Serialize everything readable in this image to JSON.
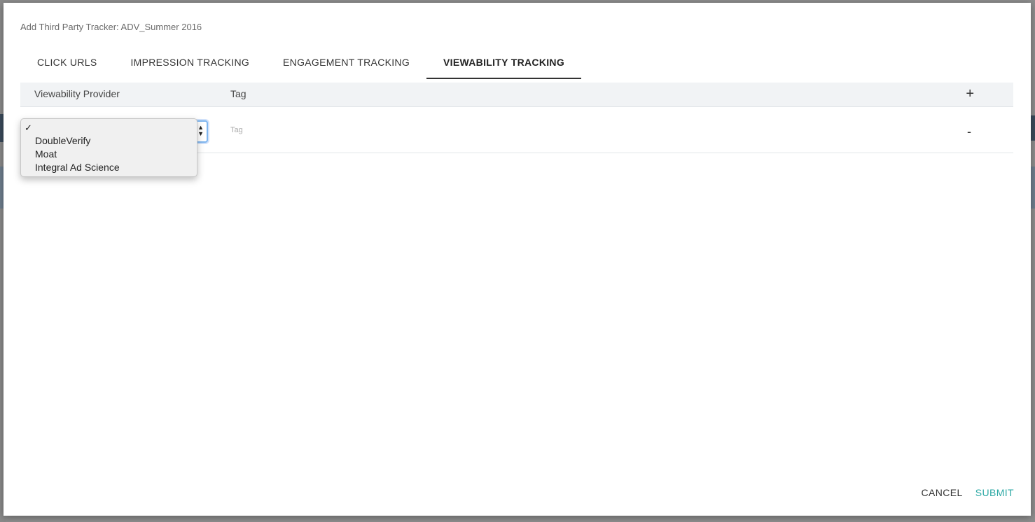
{
  "modal": {
    "title": "Add Third Party Tracker: ADV_Summer 2016"
  },
  "tabs": [
    {
      "label": "CLICK URLS"
    },
    {
      "label": "IMPRESSION TRACKING"
    },
    {
      "label": "ENGAGEMENT TRACKING"
    },
    {
      "label": "VIEWABILITY TRACKING",
      "active": true
    }
  ],
  "table": {
    "headers": {
      "provider": "Viewability Provider",
      "tag": "Tag",
      "add": "+"
    },
    "row": {
      "tag_placeholder": "Tag",
      "remove": "-"
    }
  },
  "dropdown": {
    "check": "✓",
    "options": [
      "",
      "DoubleVerify",
      "Moat",
      "Integral Ad Science"
    ]
  },
  "footer": {
    "cancel": "CANCEL",
    "submit": "SUBMIT"
  },
  "colors": {
    "accent": "#2ba8a4",
    "select_focus": "#7fb6ef",
    "header_bg": "#f1f3f5"
  }
}
